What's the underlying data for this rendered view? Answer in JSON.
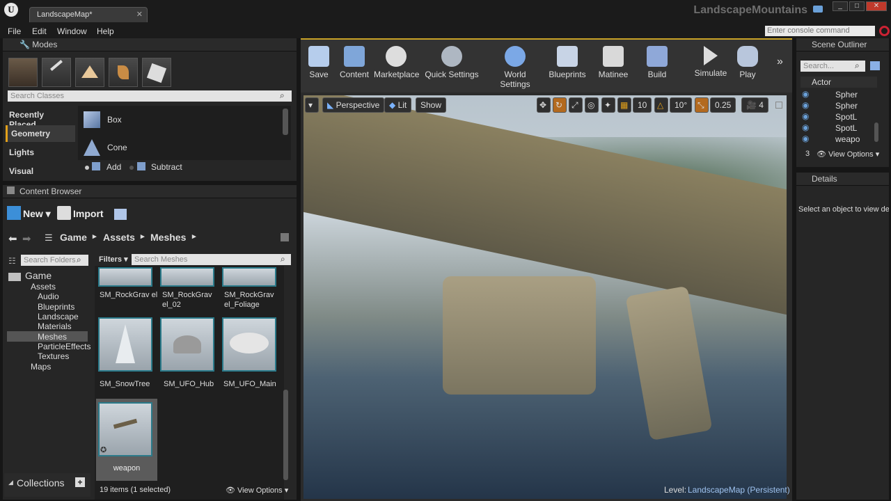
{
  "window": {
    "tab": "LandscapeMap*",
    "project": "LandscapeMountains"
  },
  "menu": [
    "File",
    "Edit",
    "Window",
    "Help"
  ],
  "console_placeholder": "Enter console command",
  "modes": {
    "title": "Modes",
    "search_placeholder": "Search Classes",
    "categories": [
      "Recently Placed",
      "Geometry",
      "Lights",
      "Visual"
    ],
    "items": [
      "Box",
      "Cone"
    ],
    "add": "Add",
    "subtract": "Subtract"
  },
  "content_browser": {
    "title": "Content Browser",
    "new": "New",
    "import": "Import",
    "breadcrumb": [
      "Game",
      "Assets",
      "Meshes"
    ],
    "search_folders": "Search Folders",
    "filters": "Filters",
    "search_meshes": "Search Meshes",
    "tree": [
      "Game",
      "Assets",
      "Audio",
      "Blueprints",
      "Landscape",
      "Materials",
      "Meshes",
      "ParticleEffects",
      "Textures",
      "Maps"
    ],
    "assets_row1": [
      "SM_RockGrav el",
      "SM_RockGrav el_02",
      "SM_RockGrav el_Foliage"
    ],
    "assets_row2": [
      "SM_SnowTree",
      "SM_UFO_Hub",
      "SM_UFO_Main"
    ],
    "asset_selected": "weapon",
    "collections": "Collections",
    "status": "19 items (1 selected)",
    "view_options": "View Options"
  },
  "toolbar": [
    "Save",
    "Content",
    "Marketplace",
    "Quick Settings",
    "World Settings",
    "Blueprints",
    "Matinee",
    "Build",
    "Simulate",
    "Play"
  ],
  "viewport": {
    "perspective": "Perspective",
    "lit": "Lit",
    "show": "Show",
    "grid": "10",
    "rot": "10°",
    "scale": "0.25",
    "cam": "4",
    "level_label": "Level:",
    "level_value": "LandscapeMap (Persistent)"
  },
  "outliner": {
    "title": "Scene Outliner",
    "search": "Search...",
    "column": "Actor",
    "rows": [
      "Spher",
      "Spher",
      "SpotL",
      "SpotL",
      "weapo"
    ],
    "count": "3",
    "view_options": "View Options"
  },
  "details": {
    "title": "Details",
    "empty": "Select an object to view de"
  }
}
